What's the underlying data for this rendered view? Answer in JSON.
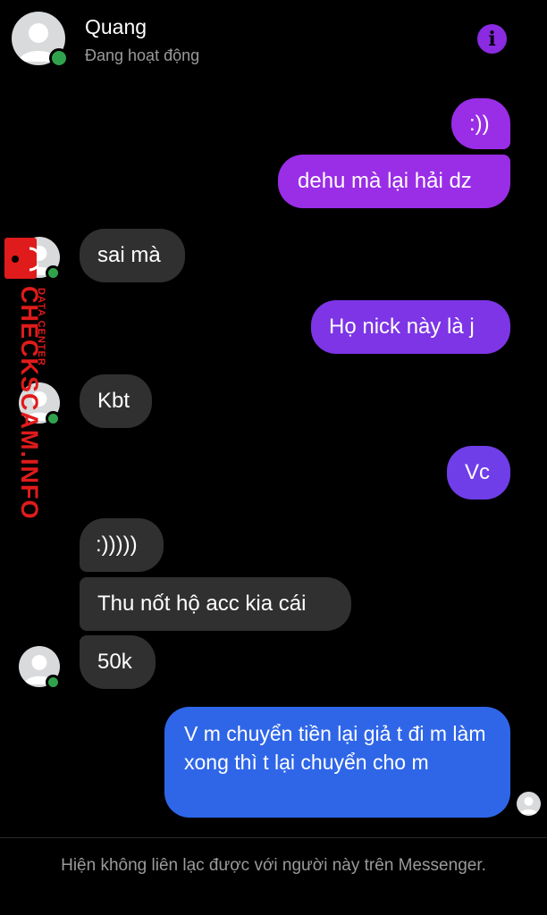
{
  "header": {
    "name": "Quang",
    "status": "Đang hoạt động",
    "info_icon": "info-icon",
    "accent": "#8a2be2"
  },
  "messages": [
    {
      "from": "me",
      "text": ":))"
    },
    {
      "from": "me",
      "text": "dehu mà lại hải dz"
    },
    {
      "from": "them",
      "text": "sai mà"
    },
    {
      "from": "me",
      "text": "Họ nick này là j"
    },
    {
      "from": "them",
      "text": "Kbt"
    },
    {
      "from": "me",
      "text": "Vc"
    },
    {
      "from": "them",
      "text": ":)))))"
    },
    {
      "from": "them",
      "text": "Thu nốt hộ acc kia cái"
    },
    {
      "from": "them",
      "text": "50k"
    },
    {
      "from": "me",
      "text": "V m chuyển tiền lại giả t đi m làm xong thì t lại chuyển cho m"
    }
  ],
  "footer": {
    "notice": "Hiện không liên lạc được với người này trên Messenger."
  },
  "watermark": {
    "main": "CHECKSCAM.INFO",
    "sub": "DATA CENTER"
  },
  "colors": {
    "bubble_purple": "#9a2de6",
    "bubble_violet": "#6f3ee8",
    "bubble_blue": "#2f66e8",
    "incoming": "#303030",
    "online": "#31a24c"
  }
}
